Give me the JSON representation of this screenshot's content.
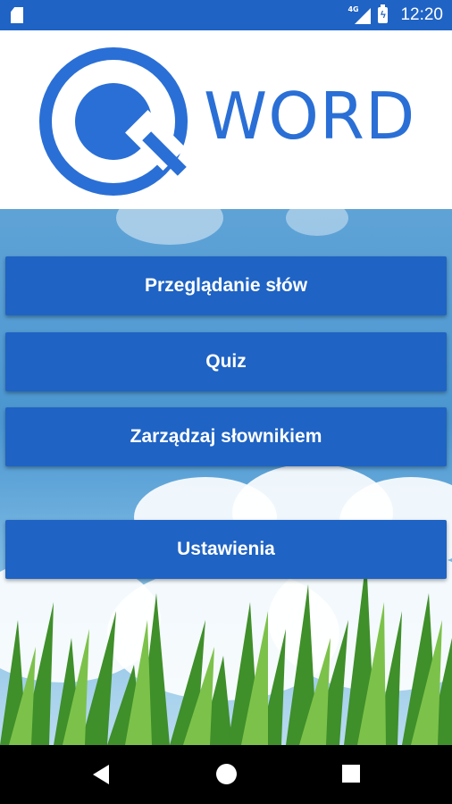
{
  "status_bar": {
    "network": "4G",
    "time": "12:20"
  },
  "logo": {
    "letter": "Q",
    "word": "WORD",
    "color": "#2a6fd6"
  },
  "menu": {
    "browse_words": "Przeglądanie słów",
    "quiz": "Quiz",
    "manage_dictionary": "Zarządzaj słownikiem",
    "settings": "Ustawienia"
  },
  "colors": {
    "accent": "#1f63c4",
    "nav_bar": "#000000"
  },
  "icons": {
    "status_left": "sd-card-icon",
    "signal": "signal-icon",
    "battery": "battery-charging-icon",
    "nav_back": "back-icon",
    "nav_home": "home-icon",
    "nav_recent": "recent-apps-icon"
  }
}
